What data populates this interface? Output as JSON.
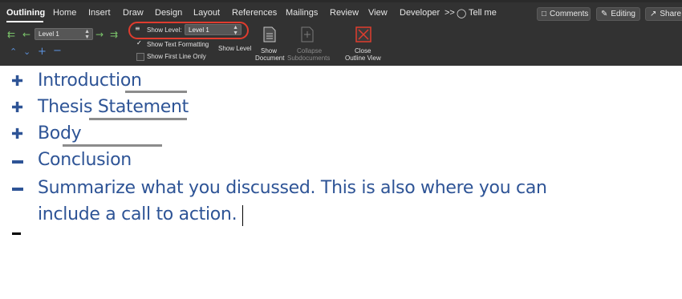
{
  "ribbon": {
    "tabs": [
      "Outlining",
      "Home",
      "Insert",
      "Draw",
      "Design",
      "Layout",
      "References",
      "Mailings",
      "Review",
      "View",
      "Developer"
    ],
    "more": ">>",
    "tell_me": "Tell me",
    "comments": "Comments",
    "editing": "Editing",
    "share": "Share",
    "level_combo_value": "Level 1",
    "show_level_label": "Show Level:",
    "show_level_value": "Level 1",
    "show_text_formatting": "Show Text Formatting",
    "show_first_line_only": "Show First Line Only",
    "show_level_button": "Show Level",
    "show_document_line1": "Show",
    "show_document_line2": "Document",
    "collapse_line1": "Collapse",
    "collapse_line2": "Subdocuments",
    "close_line1": "Close",
    "close_line2": "Outline View",
    "accent_color": "#e03c2e"
  },
  "document": {
    "items": [
      {
        "symbol": "plus",
        "text": "Introduction"
      },
      {
        "symbol": "plus",
        "text": "Thesis Statement"
      },
      {
        "symbol": "plus",
        "text": "Body"
      },
      {
        "symbol": "minus",
        "text": "Conclusion"
      },
      {
        "symbol": "minus",
        "text": "Summarize what you discussed. This is also where you can"
      }
    ],
    "continuation": "include a call to action.",
    "text_color": "#2e5496"
  }
}
